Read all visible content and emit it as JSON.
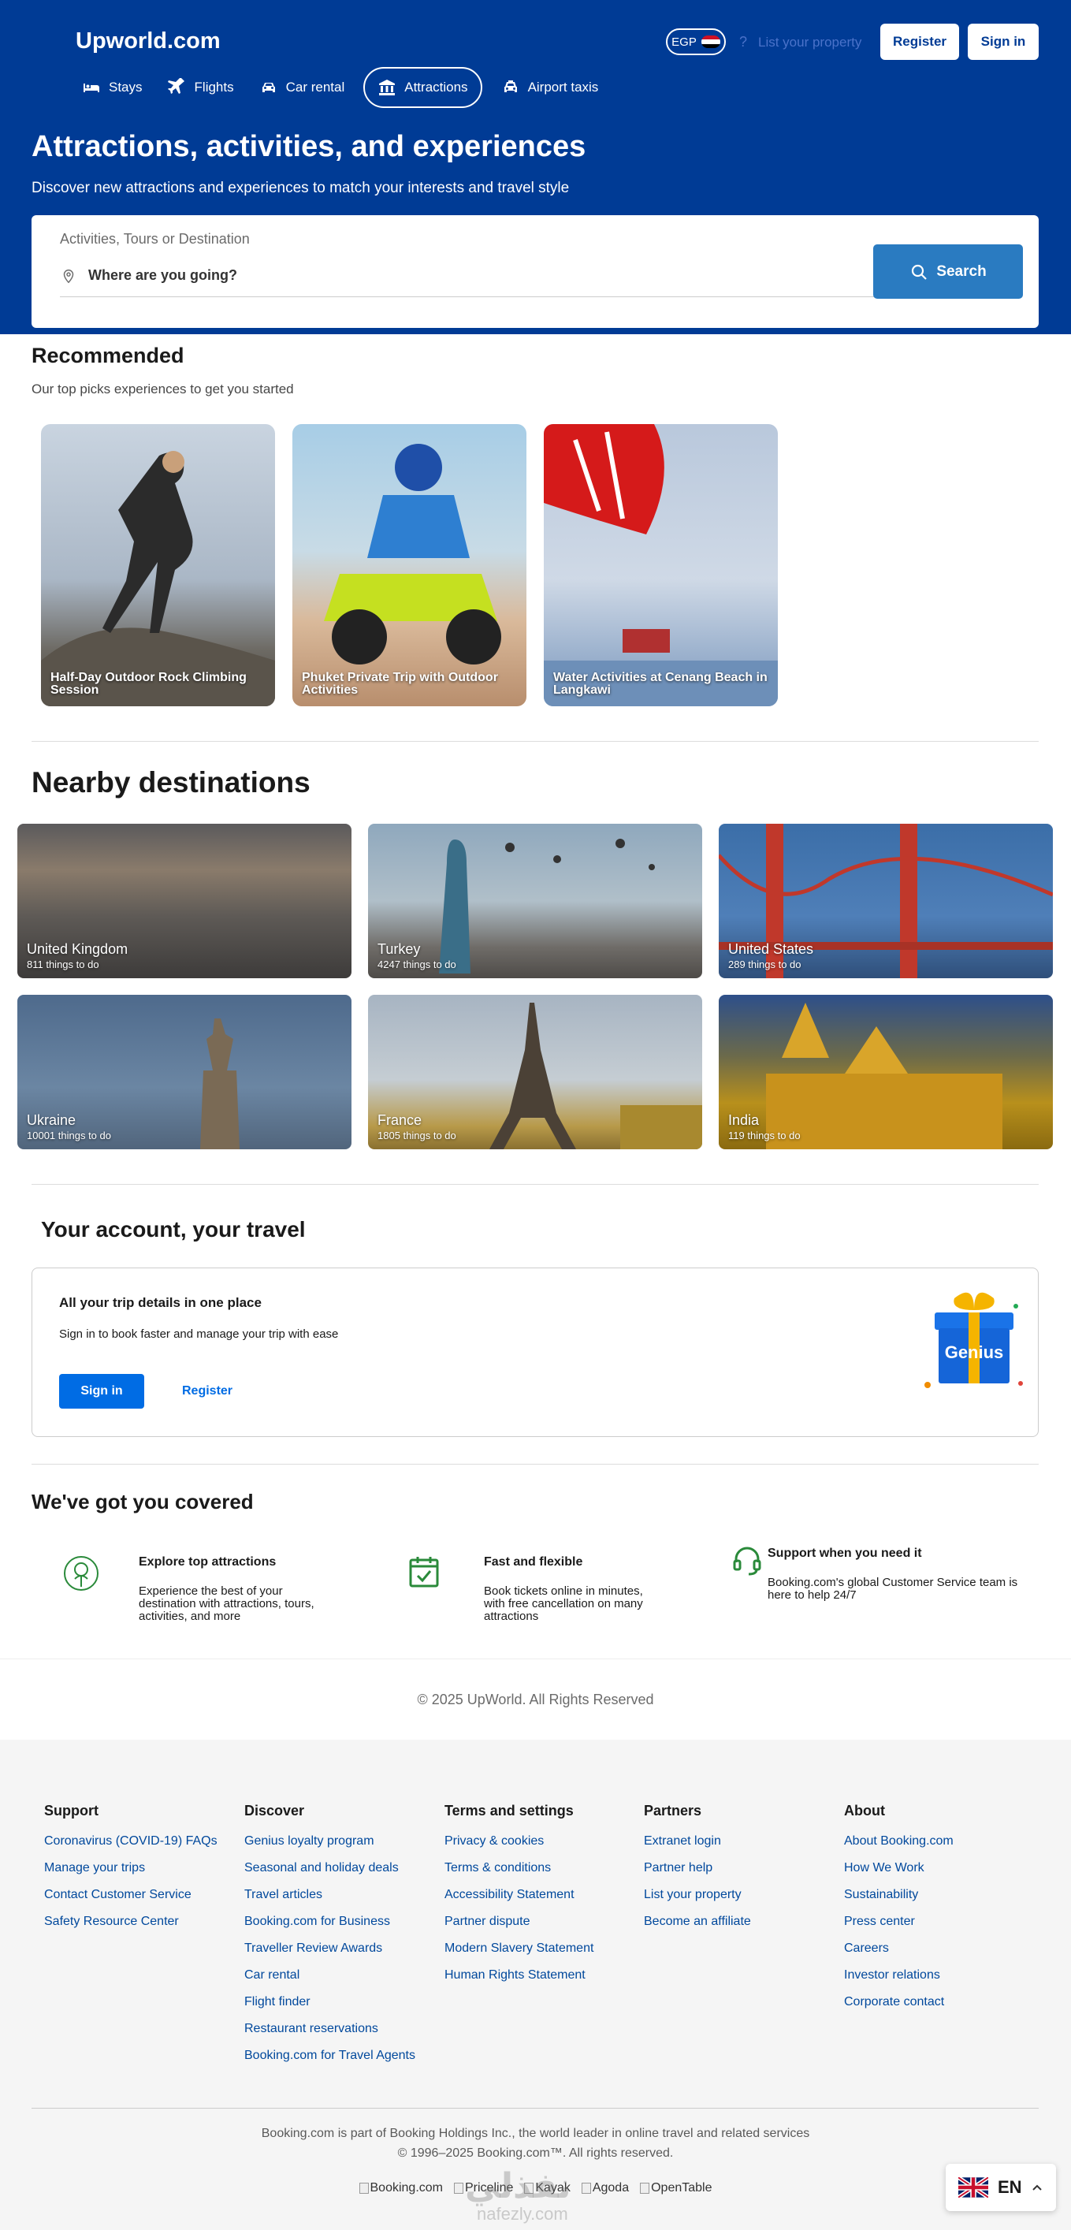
{
  "header": {
    "logo": "Upworld.com",
    "currency": "EGP",
    "help_glyph": "?",
    "list_property": "List your property",
    "register": "Register",
    "sign_in": "Sign in"
  },
  "nav": [
    {
      "label": "Stays",
      "icon": "bed-icon"
    },
    {
      "label": "Flights",
      "icon": "plane-icon"
    },
    {
      "label": "Car rental",
      "icon": "car-icon"
    },
    {
      "label": "Attractions",
      "icon": "attractions-icon",
      "active": true
    },
    {
      "label": "Airport taxis",
      "icon": "taxi-icon"
    }
  ],
  "hero": {
    "title": "Attractions, activities, and experiences",
    "subtitle": "Discover new attractions and experiences to match your interests and travel style"
  },
  "search": {
    "label": "Activities, Tours or Destination",
    "placeholder": "Where are you going?",
    "button": "Search"
  },
  "recommended": {
    "title": "Recommended",
    "subtitle": "Our top picks experiences to get you started",
    "cards": [
      {
        "caption": "Half-Day Outdoor Rock Climbing Session"
      },
      {
        "caption": "Phuket Private Trip with Outdoor Activities"
      },
      {
        "caption": "Water Activities at Cenang Beach in Langkawi"
      }
    ]
  },
  "nearby": {
    "title": "Nearby destinations",
    "items": [
      {
        "name": "United Kingdom",
        "count": "811 things to do"
      },
      {
        "name": "Turkey",
        "count": "4247 things to do"
      },
      {
        "name": "United States",
        "count": "289 things to do"
      },
      {
        "name": "Ukraine",
        "count": "10001 things to do"
      },
      {
        "name": "France",
        "count": "1805 things to do"
      },
      {
        "name": "India",
        "count": "119 things to do"
      }
    ]
  },
  "account": {
    "title": "Your account, your travel",
    "heading": "All your trip details in one place",
    "text": "Sign in to book faster and manage your trip with ease",
    "sign_in": "Sign in",
    "register": "Register",
    "badge": "Genius"
  },
  "covered": {
    "title": "We've got you covered",
    "items": [
      {
        "title": "Explore top attractions",
        "text": "Experience the best of your destination with attractions, tours, activities, and more",
        "icon": "attraction-badge-icon"
      },
      {
        "title": "Fast and flexible",
        "text": "Book tickets online in minutes, with free cancellation on many attractions",
        "icon": "calendar-check-icon"
      },
      {
        "title": "Support when you need it",
        "text": "Booking.com's global Customer Service team is here to help 24/7",
        "icon": "headset-icon"
      }
    ]
  },
  "copyright": "© 2025 UpWorld. All Rights Reserved",
  "footer": {
    "columns": [
      {
        "title": "Support",
        "links": [
          "Coronavirus (COVID-19) FAQs",
          "Manage your trips",
          "Contact Customer Service",
          "Safety Resource Center"
        ]
      },
      {
        "title": "Discover",
        "links": [
          "Genius loyalty program",
          "Seasonal and holiday deals",
          "Travel articles",
          "Booking.com for Business",
          "Traveller Review Awards",
          "Car rental",
          "Flight finder",
          "Restaurant reservations",
          "Booking.com for Travel Agents"
        ]
      },
      {
        "title": "Terms and settings",
        "links": [
          "Privacy & cookies",
          "Terms & conditions",
          "Accessibility Statement",
          "Partner dispute",
          "Modern Slavery Statement",
          "Human Rights Statement"
        ]
      },
      {
        "title": "Partners",
        "links": [
          "Extranet login",
          "Partner help",
          "List your property",
          "Become an affiliate"
        ]
      },
      {
        "title": "About",
        "links": [
          "About Booking.com",
          "How We Work",
          "Sustainability",
          "Press center",
          "Careers",
          "Investor relations",
          "Corporate contact"
        ]
      }
    ],
    "holdings": "Booking.com is part of Booking Holdings Inc., the world leader in online travel and related services",
    "rights": "© 1996–2025 Booking.com™. All rights reserved.",
    "brands": [
      "Booking.com",
      "Priceline",
      "Kayak",
      "Agoda",
      "OpenTable"
    ]
  },
  "language": {
    "code": "EN"
  },
  "watermark": {
    "arabic": "نفذلي",
    "latin": "nafezly.com"
  },
  "colors": {
    "brand_blue": "#003b95",
    "search_button": "#2a7bc1",
    "link_blue": "#006ce4"
  }
}
